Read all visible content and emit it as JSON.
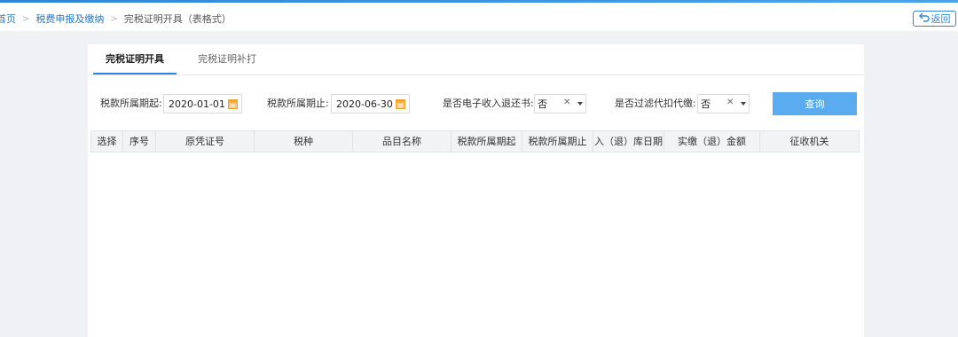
{
  "breadcrumb": {
    "items": [
      "首页",
      "税费申报及缴纳"
    ],
    "current": "完税证明开具（表格式）"
  },
  "back_button": {
    "label": "返回"
  },
  "tabs": [
    {
      "label": "完税证明开具",
      "active": true
    },
    {
      "label": "完税证明补打",
      "active": false
    }
  ],
  "filters": {
    "period_start": {
      "label": "税款所属期起:",
      "value": "2020-01-01"
    },
    "period_end": {
      "label": "税款所属期止:",
      "value": "2020-06-30"
    },
    "electronic_refund": {
      "label": "是否电子收入退还书:",
      "value": "否"
    },
    "filter_withholding": {
      "label": "是否过滤代扣代缴:",
      "value": "否"
    }
  },
  "query_button": {
    "label": "查询"
  },
  "table": {
    "columns": [
      "选择",
      "序号",
      "原凭证号",
      "税种",
      "品目名称",
      "税款所属期起",
      "税款所属期止",
      "入（退）库日期",
      "实缴（退）金额",
      "征收机关"
    ],
    "rows": []
  },
  "colors": {
    "accent": "#2f86d8",
    "query_button": "#5aabef",
    "calendar_icon": "#f0a431"
  },
  "icons": {
    "back": "return-arrow-icon",
    "calendar": "calendar-icon",
    "clear": "clear-x-icon",
    "dropdown": "caret-down-icon"
  }
}
